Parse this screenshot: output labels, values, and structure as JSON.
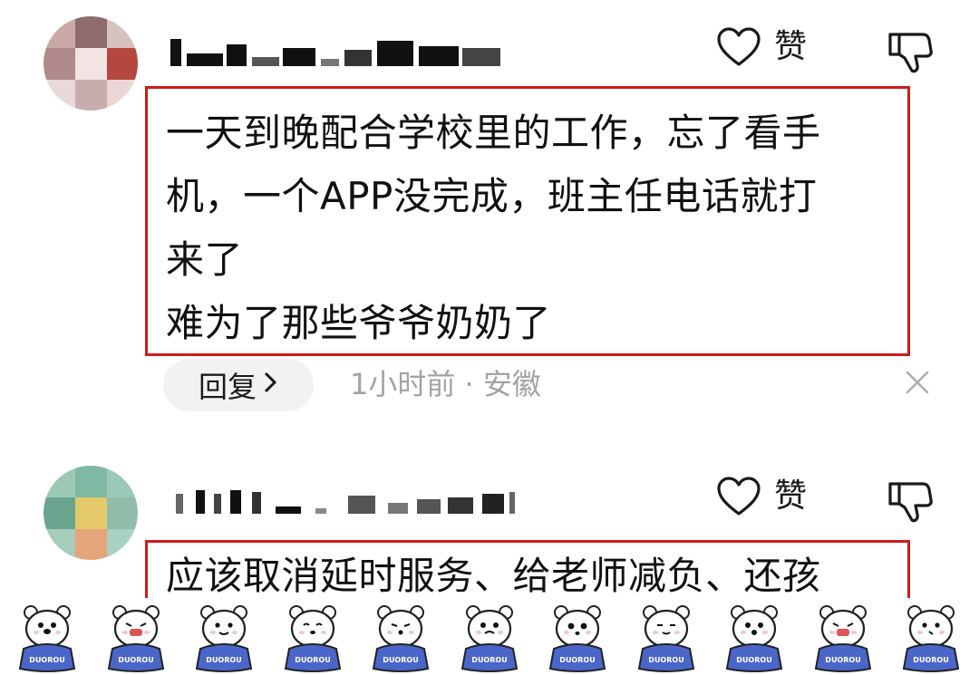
{
  "comments": [
    {
      "like_label": "赞",
      "text": "一天到晚配合学校里的工作，忘了看手\n机，一个APP没完成，班主任电话就打\n来了\n难为了那些爷爷奶奶了",
      "reply_label": "回复",
      "meta": "1小时前 · 安徽"
    },
    {
      "like_label": "赞",
      "text": "应该取消延时服务、给老师减负、还孩"
    }
  ],
  "icons": {
    "like": "heart-outline-icon",
    "dislike": "thumbs-down-icon",
    "close": "close-icon",
    "reply_chevron": "chevron-right-icon"
  },
  "stickers": {
    "caption": "DUOROU",
    "count": 11
  },
  "colors": {
    "highlight_border": "#d11a1a",
    "meta_text": "#a3a3a3",
    "reply_pill_bg": "#f2f2f2",
    "sticker_shirt": "#4a66c9"
  }
}
